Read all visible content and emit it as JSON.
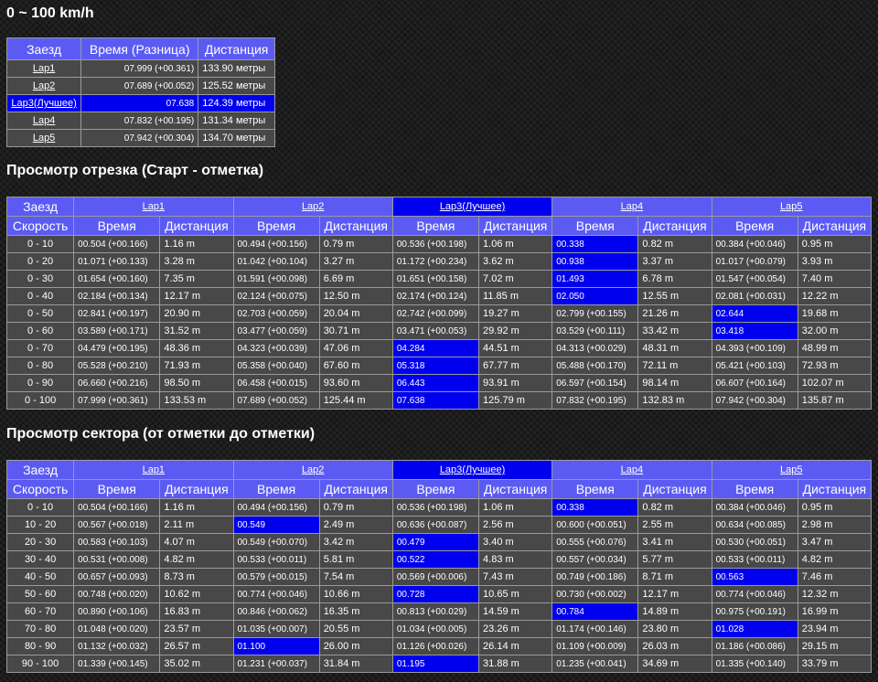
{
  "title": "0 ~ 100 km/h",
  "summary": {
    "headers": [
      "Заезд",
      "Время (Разница)",
      "Дистанция"
    ],
    "rows": [
      {
        "lap": "Lap1",
        "time": "07.999 (+00.361)",
        "dist": "133.90 метры",
        "best": false
      },
      {
        "lap": "Lap2",
        "time": "07.689 (+00.052)",
        "dist": "125.52 метры",
        "best": false
      },
      {
        "lap": "Lap3(Лучшее)",
        "time": "07.638",
        "dist": "124.39 метры",
        "best": true
      },
      {
        "lap": "Lap4",
        "time": "07.832 (+00.195)",
        "dist": "131.34 метры",
        "best": false
      },
      {
        "lap": "Lap5",
        "time": "07.942 (+00.304)",
        "dist": "134.70 метры",
        "best": false
      }
    ]
  },
  "split1": {
    "title": "Просмотр отрезка (Старт - отметка)",
    "corner_top": "Заезд",
    "corner_bottom": "Скорость",
    "time_label": "Время",
    "dist_label": "Дистанция",
    "laps": [
      "Lap1",
      "Lap2",
      "Lap3(Лучшее)",
      "Lap4",
      "Lap5"
    ],
    "best_lap_index": 2,
    "rows": [
      {
        "speed": "0 - 10",
        "cells": [
          [
            "00.504 (+00.166)",
            "1.16 m",
            false
          ],
          [
            "00.494 (+00.156)",
            "0.79 m",
            false
          ],
          [
            "00.536 (+00.198)",
            "1.06 m",
            false
          ],
          [
            "00.338",
            "0.82 m",
            true
          ],
          [
            "00.384 (+00.046)",
            "0.95 m",
            false
          ]
        ]
      },
      {
        "speed": "0 - 20",
        "cells": [
          [
            "01.071 (+00.133)",
            "3.28 m",
            false
          ],
          [
            "01.042 (+00.104)",
            "3.27 m",
            false
          ],
          [
            "01.172 (+00.234)",
            "3.62 m",
            false
          ],
          [
            "00.938",
            "3.37 m",
            true
          ],
          [
            "01.017 (+00.079)",
            "3.93 m",
            false
          ]
        ]
      },
      {
        "speed": "0 - 30",
        "cells": [
          [
            "01.654 (+00.160)",
            "7.35 m",
            false
          ],
          [
            "01.591 (+00.098)",
            "6.69 m",
            false
          ],
          [
            "01.651 (+00.158)",
            "7.02 m",
            false
          ],
          [
            "01.493",
            "6.78 m",
            true
          ],
          [
            "01.547 (+00.054)",
            "7.40 m",
            false
          ]
        ]
      },
      {
        "speed": "0 - 40",
        "cells": [
          [
            "02.184 (+00.134)",
            "12.17 m",
            false
          ],
          [
            "02.124 (+00.075)",
            "12.50 m",
            false
          ],
          [
            "02.174 (+00.124)",
            "11.85 m",
            false
          ],
          [
            "02.050",
            "12.55 m",
            true
          ],
          [
            "02.081 (+00.031)",
            "12.22 m",
            false
          ]
        ]
      },
      {
        "speed": "0 - 50",
        "cells": [
          [
            "02.841 (+00.197)",
            "20.90 m",
            false
          ],
          [
            "02.703 (+00.059)",
            "20.04 m",
            false
          ],
          [
            "02.742 (+00.099)",
            "19.27 m",
            false
          ],
          [
            "02.799 (+00.155)",
            "21.26 m",
            false
          ],
          [
            "02.644",
            "19.68 m",
            true
          ]
        ]
      },
      {
        "speed": "0 - 60",
        "cells": [
          [
            "03.589 (+00.171)",
            "31.52 m",
            false
          ],
          [
            "03.477 (+00.059)",
            "30.71 m",
            false
          ],
          [
            "03.471 (+00.053)",
            "29.92 m",
            false
          ],
          [
            "03.529 (+00.111)",
            "33.42 m",
            false
          ],
          [
            "03.418",
            "32.00 m",
            true
          ]
        ]
      },
      {
        "speed": "0 - 70",
        "cells": [
          [
            "04.479 (+00.195)",
            "48.36 m",
            false
          ],
          [
            "04.323 (+00.039)",
            "47.06 m",
            false
          ],
          [
            "04.284",
            "44.51 m",
            true
          ],
          [
            "04.313 (+00.029)",
            "48.31 m",
            false
          ],
          [
            "04.393 (+00.109)",
            "48.99 m",
            false
          ]
        ]
      },
      {
        "speed": "0 - 80",
        "cells": [
          [
            "05.528 (+00.210)",
            "71.93 m",
            false
          ],
          [
            "05.358 (+00.040)",
            "67.60 m",
            false
          ],
          [
            "05.318",
            "67.77 m",
            true
          ],
          [
            "05.488 (+00.170)",
            "72.11 m",
            false
          ],
          [
            "05.421 (+00.103)",
            "72.93 m",
            false
          ]
        ]
      },
      {
        "speed": "0 - 90",
        "cells": [
          [
            "06.660 (+00.216)",
            "98.50 m",
            false
          ],
          [
            "06.458 (+00.015)",
            "93.60 m",
            false
          ],
          [
            "06.443",
            "93.91 m",
            true
          ],
          [
            "06.597 (+00.154)",
            "98.14 m",
            false
          ],
          [
            "06.607 (+00.164)",
            "102.07 m",
            false
          ]
        ]
      },
      {
        "speed": "0 - 100",
        "cells": [
          [
            "07.999 (+00.361)",
            "133.53 m",
            false
          ],
          [
            "07.689 (+00.052)",
            "125.44 m",
            false
          ],
          [
            "07.638",
            "125.79 m",
            true
          ],
          [
            "07.832 (+00.195)",
            "132.83 m",
            false
          ],
          [
            "07.942 (+00.304)",
            "135.87 m",
            false
          ]
        ]
      }
    ]
  },
  "split2": {
    "title": "Просмотр сектора (от отметки до отметки)",
    "corner_top": "Заезд",
    "corner_bottom": "Скорость",
    "time_label": "Время",
    "dist_label": "Дистанция",
    "laps": [
      "Lap1",
      "Lap2",
      "Lap3(Лучшее)",
      "Lap4",
      "Lap5"
    ],
    "best_lap_index": 2,
    "rows": [
      {
        "speed": "0 - 10",
        "cells": [
          [
            "00.504 (+00.166)",
            "1.16 m",
            false
          ],
          [
            "00.494 (+00.156)",
            "0.79 m",
            false
          ],
          [
            "00.536 (+00.198)",
            "1.06 m",
            false
          ],
          [
            "00.338",
            "0.82 m",
            true
          ],
          [
            "00.384 (+00.046)",
            "0.95 m",
            false
          ]
        ]
      },
      {
        "speed": "10 - 20",
        "cells": [
          [
            "00.567 (+00.018)",
            "2.11 m",
            false
          ],
          [
            "00.549",
            "2.49 m",
            true
          ],
          [
            "00.636 (+00.087)",
            "2.56 m",
            false
          ],
          [
            "00.600 (+00.051)",
            "2.55 m",
            false
          ],
          [
            "00.634 (+00.085)",
            "2.98 m",
            false
          ]
        ]
      },
      {
        "speed": "20 - 30",
        "cells": [
          [
            "00.583 (+00.103)",
            "4.07 m",
            false
          ],
          [
            "00.549 (+00.070)",
            "3.42 m",
            false
          ],
          [
            "00.479",
            "3.40 m",
            true
          ],
          [
            "00.555 (+00.076)",
            "3.41 m",
            false
          ],
          [
            "00.530 (+00.051)",
            "3.47 m",
            false
          ]
        ]
      },
      {
        "speed": "30 - 40",
        "cells": [
          [
            "00.531 (+00.008)",
            "4.82 m",
            false
          ],
          [
            "00.533 (+00.011)",
            "5.81 m",
            false
          ],
          [
            "00.522",
            "4.83 m",
            true
          ],
          [
            "00.557 (+00.034)",
            "5.77 m",
            false
          ],
          [
            "00.533 (+00.011)",
            "4.82 m",
            false
          ]
        ]
      },
      {
        "speed": "40 - 50",
        "cells": [
          [
            "00.657 (+00.093)",
            "8.73 m",
            false
          ],
          [
            "00.579 (+00.015)",
            "7.54 m",
            false
          ],
          [
            "00.569 (+00.006)",
            "7.43 m",
            false
          ],
          [
            "00.749 (+00.186)",
            "8.71 m",
            false
          ],
          [
            "00.563",
            "7.46 m",
            true
          ]
        ]
      },
      {
        "speed": "50 - 60",
        "cells": [
          [
            "00.748 (+00.020)",
            "10.62 m",
            false
          ],
          [
            "00.774 (+00.046)",
            "10.66 m",
            false
          ],
          [
            "00.728",
            "10.65 m",
            true
          ],
          [
            "00.730 (+00.002)",
            "12.17 m",
            false
          ],
          [
            "00.774 (+00.046)",
            "12.32 m",
            false
          ]
        ]
      },
      {
        "speed": "60 - 70",
        "cells": [
          [
            "00.890 (+00.106)",
            "16.83 m",
            false
          ],
          [
            "00.846 (+00.062)",
            "16.35 m",
            false
          ],
          [
            "00.813 (+00.029)",
            "14.59 m",
            false
          ],
          [
            "00.784",
            "14.89 m",
            true
          ],
          [
            "00.975 (+00.191)",
            "16.99 m",
            false
          ]
        ]
      },
      {
        "speed": "70 - 80",
        "cells": [
          [
            "01.048 (+00.020)",
            "23.57 m",
            false
          ],
          [
            "01.035 (+00.007)",
            "20.55 m",
            false
          ],
          [
            "01.034 (+00.005)",
            "23.26 m",
            false
          ],
          [
            "01.174 (+00.146)",
            "23.80 m",
            false
          ],
          [
            "01.028",
            "23.94 m",
            true
          ]
        ]
      },
      {
        "speed": "80 - 90",
        "cells": [
          [
            "01.132 (+00.032)",
            "26.57 m",
            false
          ],
          [
            "01.100",
            "26.00 m",
            true
          ],
          [
            "01.126 (+00.026)",
            "26.14 m",
            false
          ],
          [
            "01.109 (+00.009)",
            "26.03 m",
            false
          ],
          [
            "01.186 (+00.086)",
            "29.15 m",
            false
          ]
        ]
      },
      {
        "speed": "90 - 100",
        "cells": [
          [
            "01.339 (+00.145)",
            "35.02 m",
            false
          ],
          [
            "01.231 (+00.037)",
            "31.84 m",
            false
          ],
          [
            "01.195",
            "31.88 m",
            true
          ],
          [
            "01.235 (+00.041)",
            "34.69 m",
            false
          ],
          [
            "01.335 (+00.140)",
            "33.79 m",
            false
          ]
        ]
      }
    ]
  }
}
